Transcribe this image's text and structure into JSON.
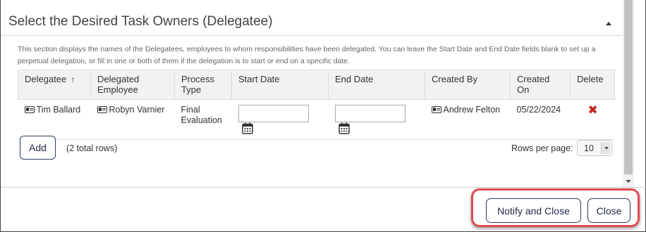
{
  "section": {
    "title": "Select the Desired Task Owners (Delegatee)",
    "description": "This section displays the names of the Delegatees, employees to whom responsibilities have been delegated. You can leave the Start Date and End Date fields blank to set up a perpetual delegation, or fill in one or both of them if the delegation is to start or end on a specific date."
  },
  "table": {
    "columns": {
      "delegatee": "Delegatee",
      "sort_indicator": "↑",
      "delegated_employee": "Delegated Employee",
      "process_type": "Process Type",
      "start_date": "Start Date",
      "end_date": "End Date",
      "created_by": "Created By",
      "created_on": "Created On",
      "delete": "Delete"
    },
    "rows": [
      {
        "delegatee": "Tim Ballard",
        "delegated_employee": "Robyn Varnier",
        "process_type": "Final Evaluation",
        "start_date": "",
        "end_date": "",
        "created_by": "Andrew Felton",
        "created_on": "05/22/2024",
        "delete_glyph": "✖"
      }
    ]
  },
  "pagination": {
    "add_label": "Add",
    "total_rows_text": "(2 total rows)",
    "rows_per_page_label": "Rows per page:",
    "rows_per_page_value": "10"
  },
  "footer": {
    "notify_close_label": "Notify and Close",
    "close_label": "Close"
  },
  "colors": {
    "accent_border": "#2b3d5a",
    "delete_red": "#c0241b",
    "highlight_red": "#e04a52"
  },
  "icons": [
    "id-card-icon",
    "calendar-icon",
    "delete-x-icon",
    "chevron-up-icon",
    "chevron-down-icon"
  ]
}
